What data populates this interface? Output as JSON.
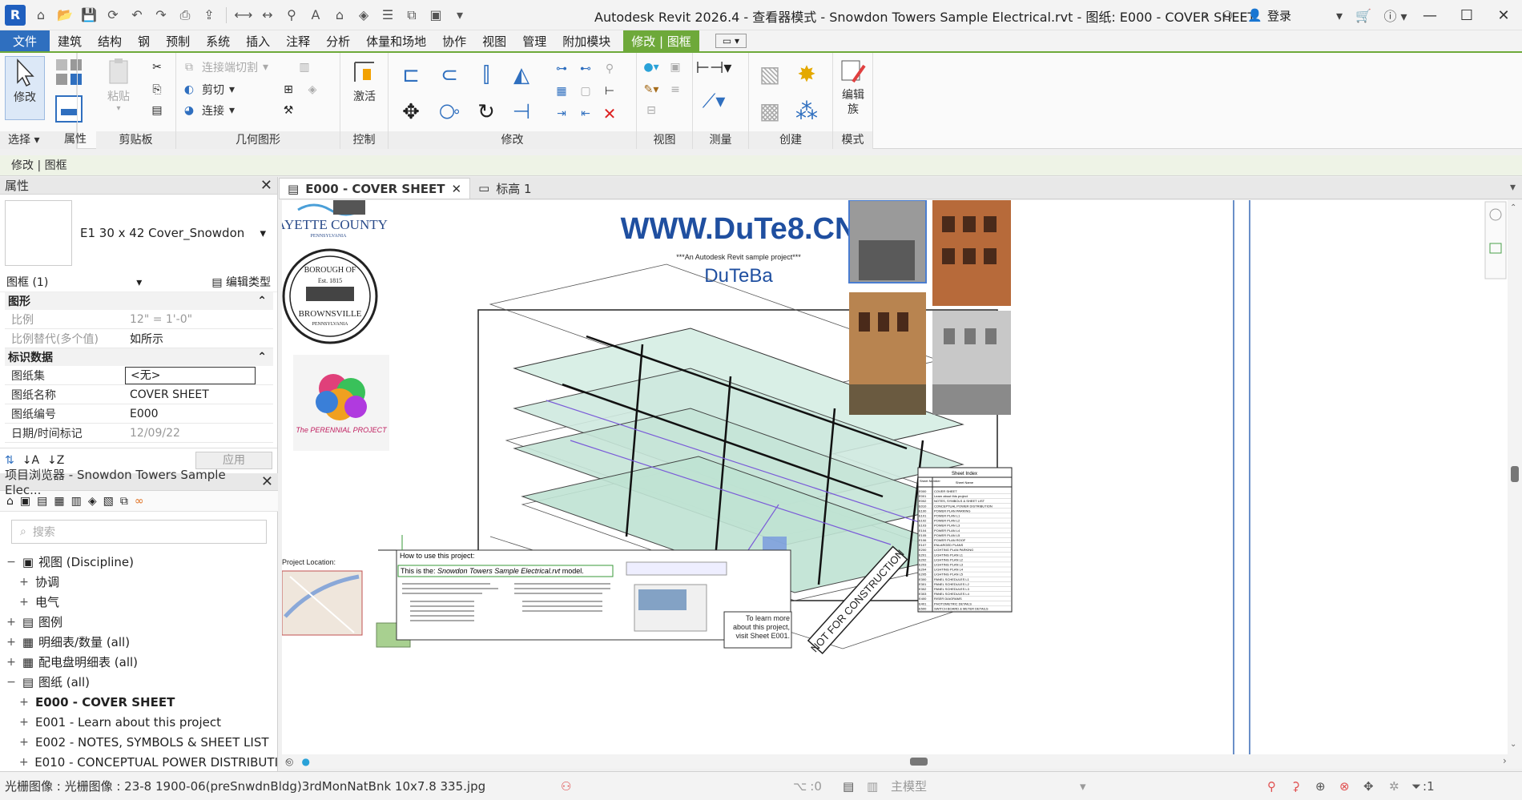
{
  "window": {
    "title": "Autodesk Revit 2026.4 - 查看器模式 - Snowdon Towers Sample Electrical.rvt - 图纸: E000 - COVER SHEET",
    "login": "登录"
  },
  "menu": {
    "file": "文件",
    "tabs": [
      "建筑",
      "结构",
      "钢",
      "预制",
      "系统",
      "插入",
      "注释",
      "分析",
      "体量和场地",
      "协作",
      "视图",
      "管理",
      "附加模块"
    ],
    "context_tab": "修改 | 图框"
  },
  "ribbon": {
    "select": {
      "modify": "修改",
      "label": "选择 ▾"
    },
    "properties": {
      "label": "属性"
    },
    "clipboard": {
      "paste": "粘贴",
      "label": "剪贴板"
    },
    "geometry": {
      "cope": "连接端切割",
      "cut": "剪切",
      "join": "连接",
      "label": "几何图形"
    },
    "controls": {
      "activate": "激活",
      "label": "控制"
    },
    "modify": {
      "label": "修改"
    },
    "view": {
      "label": "视图"
    },
    "measure": {
      "label": "测量"
    },
    "create": {
      "label": "创建"
    },
    "mode": {
      "edit_family": "编辑族",
      "label": "模式"
    }
  },
  "options_bar": {
    "text": "修改 | 图框"
  },
  "properties": {
    "title": "属性",
    "type_name": "E1 30 x 42 Cover_Snowdon",
    "instance": "图框 (1)",
    "edit_type": "编辑类型",
    "sections": {
      "graphics": "图形",
      "identity": "标识数据"
    },
    "rows_graphics": [
      {
        "k": "比例",
        "v": "12\" = 1'-0\""
      },
      {
        "k": "比例替代(多个值)",
        "v": "如所示"
      }
    ],
    "rows_identity": [
      {
        "k": "图纸集",
        "v": "<无>"
      },
      {
        "k": "图纸名称",
        "v": "COVER SHEET"
      },
      {
        "k": "图纸编号",
        "v": "E000"
      },
      {
        "k": "日期/时间标记",
        "v": "12/09/22"
      }
    ],
    "apply": "应用"
  },
  "browser": {
    "title": "项目浏览器 - Snowdon Towers Sample Elec...",
    "search_placeholder": "搜索",
    "nodes": [
      {
        "label": "视图 (Discipline)",
        "level": 0,
        "tog": "−",
        "icon": "views"
      },
      {
        "label": "协调",
        "level": 1,
        "tog": "+",
        "icon": ""
      },
      {
        "label": "电气",
        "level": 1,
        "tog": "+",
        "icon": ""
      },
      {
        "label": "图例",
        "level": 0,
        "tog": "+",
        "icon": "legend"
      },
      {
        "label": "明细表/数量 (all)",
        "level": 0,
        "tog": "+",
        "icon": "schedule"
      },
      {
        "label": "配电盘明细表 (all)",
        "level": 0,
        "tog": "+",
        "icon": "schedule"
      },
      {
        "label": "图纸 (all)",
        "level": 0,
        "tog": "−",
        "icon": "sheets"
      },
      {
        "label": "E000 - COVER SHEET",
        "level": 1,
        "tog": "+",
        "icon": "",
        "bold": true
      },
      {
        "label": "E001 - Learn about this project",
        "level": 1,
        "tog": "+",
        "icon": ""
      },
      {
        "label": "E002 - NOTES, SYMBOLS & SHEET LIST",
        "level": 1,
        "tog": "+",
        "icon": ""
      },
      {
        "label": "E010 - CONCEPTUAL POWER DISTRIBUTI",
        "level": 1,
        "tog": "+",
        "icon": ""
      }
    ]
  },
  "doc_tabs": [
    {
      "label": "E000 - COVER SHEET",
      "active": true
    },
    {
      "label": "标高 1",
      "active": false
    }
  ],
  "sheet": {
    "logo_fayette": "FAYETTE COUNTY",
    "logo_fayette_sub": "PENNSYLVANIA",
    "seal_top": "BOROUGH OF",
    "seal_est": "Est. 1815",
    "seal_name": "BROWNSVILLE",
    "seal_state": "PENNSYLVANIA",
    "perennial": "The PERENNIAL PROJECT",
    "watermark": "WWW.DuTe8.CN",
    "subtitle": "***An Autodesk Revit sample project***",
    "brand": "DuTeBa",
    "how_to": "How to use this project:",
    "this_is_prefix": "This is the: ",
    "this_is_model": "Snowdon Towers Sample Electrical.rvt",
    "this_is_suffix": " model.",
    "project_location": "Project Location:",
    "learn_more": "To learn more about this project, visit Sheet E001.",
    "not_for_construction": "NOT FOR CONSTRUCTION",
    "sheet_index_title": "Sheet Index",
    "sheet_index_headers": [
      "Sheet Number",
      "Sheet Name"
    ],
    "sheet_index_rows": [
      [
        "E000",
        "COVER SHEET"
      ],
      [
        "E001",
        "Learn about this project"
      ],
      [
        "E002",
        "NOTES, SYMBOLS & SHEET LIST"
      ],
      [
        "E010",
        "CONCEPTUAL POWER DISTRIBUTION"
      ],
      [
        "E100",
        "POWER PLAN PARKING"
      ],
      [
        "E101",
        "POWER PLAN L1"
      ],
      [
        "E102",
        "POWER PLAN L2"
      ],
      [
        "E103",
        "POWER PLAN L3"
      ],
      [
        "E104",
        "POWER PLAN L4"
      ],
      [
        "E105",
        "POWER PLAN L5"
      ],
      [
        "E106",
        "POWER PLAN ROOF"
      ],
      [
        "E107",
        "ENLARGED PLANS"
      ],
      [
        "E200",
        "LIGHTING PLAN PARKING"
      ],
      [
        "E201",
        "LIGHTING PLAN L1"
      ],
      [
        "E202",
        "LIGHTING PLAN L2"
      ],
      [
        "E203",
        "LIGHTING PLAN L3"
      ],
      [
        "E204",
        "LIGHTING PLAN L4"
      ],
      [
        "E205",
        "LIGHTING PLAN L5"
      ],
      [
        "E300",
        "PANEL SCHEDULES L1"
      ],
      [
        "E301",
        "PANEL SCHEDULES L2"
      ],
      [
        "E302",
        "PANEL SCHEDULES L3"
      ],
      [
        "E303",
        "PANEL SCHEDULES L4"
      ],
      [
        "E400",
        "RISER DIAGRAMS"
      ],
      [
        "E401",
        "PHOTOMETRIC DETAILS"
      ],
      [
        "E500",
        "SWITCH BOARD & METER DETAILS"
      ]
    ]
  },
  "status": {
    "text": "光栅图像 : 光栅图像 : 23-8 1900-06(preSnwdnBldg)3rdMonNatBnk 10x7.8 335.jpg",
    "count_zero": ":0",
    "model": "主模型",
    "filter_count": ":1"
  },
  "colors": {
    "accent_blue": "#2f6fbf",
    "context_green": "#6ea93a",
    "watermark_blue": "#1f4fa0"
  }
}
